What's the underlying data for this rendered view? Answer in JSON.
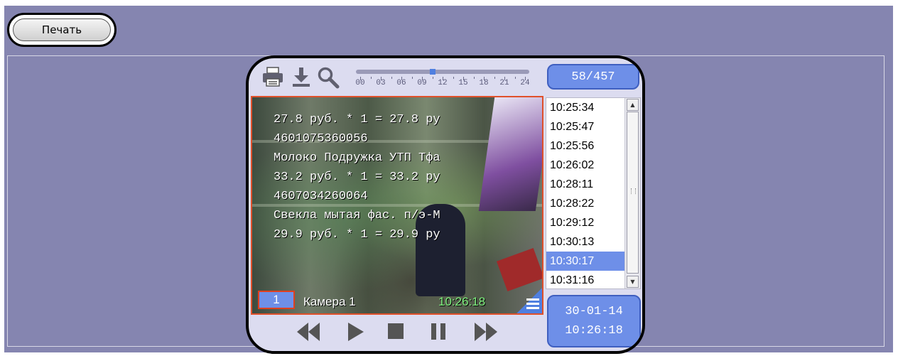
{
  "toolbar": {
    "print_button_label": "Печать"
  },
  "player": {
    "icons": [
      "printer-icon",
      "download-icon",
      "search-icon"
    ],
    "timeline": {
      "hour_labels": [
        "00",
        "03",
        "06",
        "09",
        "12",
        "15",
        "18",
        "21",
        "24"
      ],
      "position_fraction": 0.44
    },
    "counter": "58/457",
    "receipt_overlay": [
      "27.8 руб. * 1 = 27.8 ру",
      "4601075360056",
      "Молоко Подружка УТП Тфа",
      "33.2 руб. * 1 = 33.2 ру",
      "4607034260064",
      "Свекла мытая фас. п/э-М",
      "29.9 руб. * 1 = 29.9 ру"
    ],
    "camera_number": "1",
    "camera_name": "Камера 1",
    "camera_time": "10:26:18",
    "times": [
      "10:25:34",
      "10:25:47",
      "10:25:56",
      "10:26:02",
      "10:28:11",
      "10:28:22",
      "10:29:12",
      "10:30:13",
      "10:30:17",
      "10:31:16"
    ],
    "selected_time_index": 8,
    "date": "30-01-14",
    "time": "10:26:18",
    "controls": [
      "rewind",
      "play",
      "stop",
      "pause",
      "fast-forward"
    ]
  },
  "colors": {
    "background": "#8585b0",
    "accent": "#6e8fe8",
    "video_border": "#e0502a",
    "timestamp_green": "#7ef07e"
  }
}
